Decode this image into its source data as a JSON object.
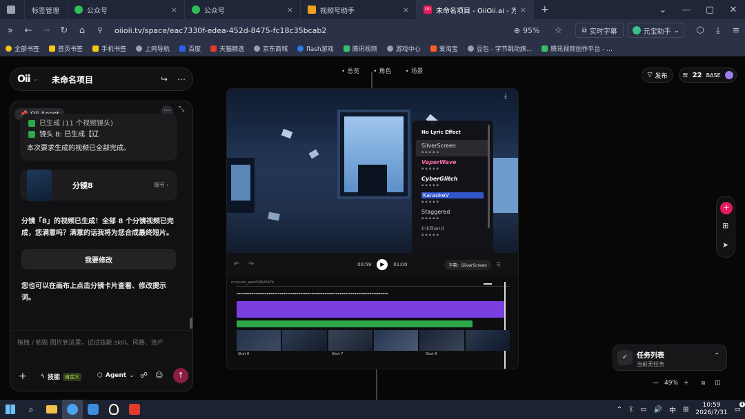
{
  "browser": {
    "tabs": [
      {
        "label": "标签管理",
        "active": false
      },
      {
        "label": "公众号",
        "active": false
      },
      {
        "label": "公众号",
        "active": false
      },
      {
        "label": "视频号助手",
        "active": false
      },
      {
        "label": "未命名项目 - OiiOii.ai - 为你闪",
        "active": true
      }
    ],
    "new_tab": "+",
    "url": "oiioii.tv/space/eac7330f-edea-452d-8475-fc18c35bcab2",
    "zoom": "95%",
    "right_items": [
      "实时字幕",
      "元宝助手"
    ],
    "bookmarks": [
      "全部书签",
      "首页书签",
      "手机书签",
      "上网导航",
      "百度",
      "天猫精选",
      "京东商城",
      "flash游戏",
      "腾讯视频",
      "游戏中心",
      "爱淘宝",
      "豆包 - 字节跳动旗...",
      "腾讯视频创作平台 - ..."
    ]
  },
  "app": {
    "logo": "Oii",
    "project_name": "未命名项目",
    "agent_badge": "Oii Agent",
    "msg_partial_1": "已生成 (11 个视频镜头)",
    "msg_partial_2": "镜头 8: 已生成【辽",
    "msg_complete": "本次要求生成的视频已全部完成。",
    "shot_card": {
      "title": "分镜8",
      "details": "细节"
    },
    "message": "分镜「8」的视频已生成！全部 8 个分镜视频已完成，您满意吗？满意的话我将为您合成最终短片。",
    "modify_button": "我要修改",
    "hint": "您也可以在画布上点击分镜卡片查看、修改提示词。",
    "input_placeholder": "拖拽 / 粘贴 图片到这里，试试技能 skill、风格、资产",
    "toolbar": {
      "skill": "技能",
      "custom": "自定义",
      "agent": "Agent"
    },
    "canvas_tabs": [
      "总览",
      "角色",
      "场景"
    ],
    "publish": "发布",
    "credits": "22",
    "plan": "BASE",
    "editor": {
      "lyric_header": "No Lyric Effect",
      "lyric_effects": [
        "SilverScreen",
        "VaporWave",
        "CyberGlitch",
        "KaraokeV",
        "Staggered",
        "InkBand"
      ],
      "time_current": "00:59",
      "time_total": "01:00",
      "subtitle_label": "字幕：SilverScreen",
      "clip_filename": "mubcom_aeed3d6d3d7b",
      "shot_labels": [
        "Shot 8",
        "Shot 7",
        "Shot 8"
      ]
    },
    "tasks": {
      "title": "任务列表",
      "subtitle": "当前无任务"
    },
    "zoom": "49%"
  },
  "taskbar": {
    "time": "10:59",
    "date": "2026/7/31",
    "ime": "中",
    "notif": "4"
  },
  "colors": {
    "accent_pink": "#e6195e",
    "purple_track": "#7b3fe0",
    "green_track": "#2ea84a",
    "custom_badge": "#c7e650"
  }
}
